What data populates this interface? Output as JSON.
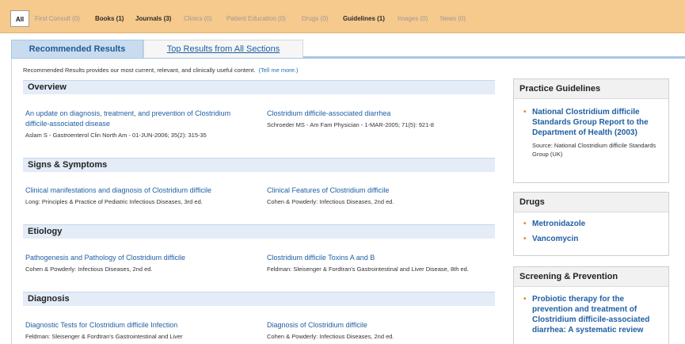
{
  "filters": [
    {
      "label": "All"
    },
    {
      "label": "First Consult (0)"
    },
    {
      "label": "Books (1)"
    },
    {
      "label": "Journals (3)"
    },
    {
      "label": "Clinics (0)"
    },
    {
      "label": "Patient Education (0)"
    },
    {
      "label": "Drugs (0)"
    },
    {
      "label": "Guidelines (1)"
    },
    {
      "label": "Images (0)"
    },
    {
      "label": "News (0)"
    }
  ],
  "tabs": [
    "Recommended Results",
    "Top Results from All Sections"
  ],
  "intro": {
    "text": "Recommended Results provides our most current, relevant, and clinically useful content.",
    "link": "(Tell me more.)"
  },
  "sections": [
    {
      "heading": "Overview",
      "results": [
        {
          "title": "An update on diagnosis, treatment, and prevention of Clostridium difficile-associated disease",
          "source": "Aslam S - Gastroenterol Clin North Am - 01-JUN-2006; 35(2): 315-35"
        },
        {
          "title": "Clostridium difficile-associated diarrhea",
          "source": "Schroeder MS - Am Fam Physician - 1-MAR-2005; 71(5): 921-8"
        }
      ]
    },
    {
      "heading": "Signs & Symptoms",
      "results": [
        {
          "title": "Clinical manifestations and diagnosis of Clostridium difficile",
          "source": "Long: Principles & Practice of Pediatric Infectious Diseases, 3rd ed."
        },
        {
          "title": "Clinical Features of Clostridium difficile",
          "source": "Cohen & Powderly: Infectious Diseases, 2nd ed."
        }
      ]
    },
    {
      "heading": "Etiology",
      "results": [
        {
          "title": "Pathogenesis and Pathology of Clostridium difficile",
          "source": "Cohen & Powderly: Infectious Diseases, 2nd ed."
        },
        {
          "title": "Clostridium difficile Toxins A and B",
          "source": "Feldman: Sleisenger & Fordtran's Gastrointestinal and Liver Disease, 8th ed."
        }
      ]
    },
    {
      "heading": "Diagnosis",
      "results": [
        {
          "title": "Diagnostic Tests for Clostridium difficile Infection",
          "source": "Feldman: Sleisenger & Fordtran's Gastrointestinal and Liver"
        },
        {
          "title": "Diagnosis of Clostridium difficile",
          "source": "Cohen & Powderly: Infectious Diseases, 2nd ed."
        }
      ]
    }
  ],
  "sidebar": {
    "guidelines": {
      "heading": "Practice Guidelines",
      "title": "National Clostridium difficile Standards Group Report to the Department of Health (2003)",
      "source": "Source: National Clostridium difficile Standards Group (UK)"
    },
    "drugs": {
      "heading": "Drugs",
      "items": [
        "Metronidazole",
        "Vancomycin"
      ]
    },
    "screening": {
      "heading": "Screening & Prevention",
      "title": "Probiotic therapy for the prevention and treatment of Clostridium difficile-associated diarrhea: A systematic review"
    }
  },
  "colors": {
    "accent": "#1f5fa3",
    "filterbar": "#f6c98c",
    "section_bg": "#e3ecf7",
    "bullet": "#e08d21"
  }
}
